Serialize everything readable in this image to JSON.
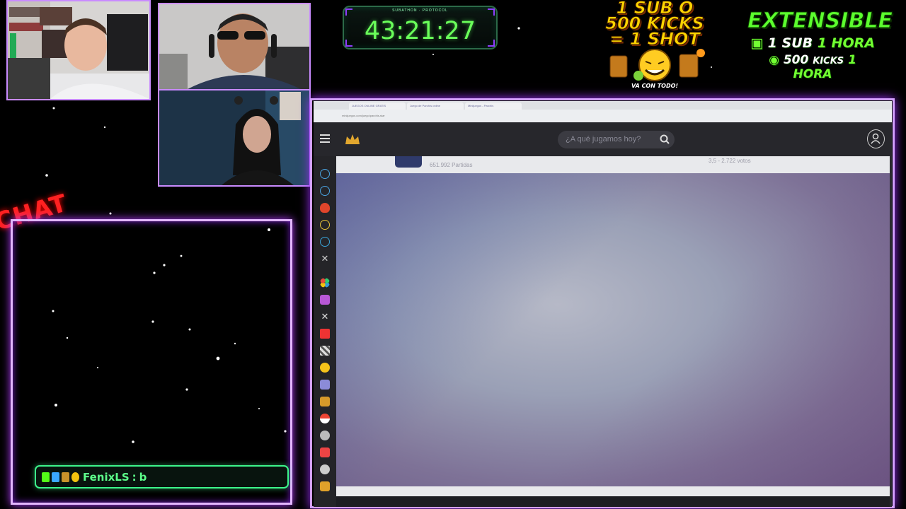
{
  "timer": {
    "label": "SUBATHON · PROTOCOL",
    "value": "43:21:27"
  },
  "promo_left": {
    "line1": "1 SUB O",
    "line2": "500 KICKS",
    "line3": "= 1 SHOT",
    "tagline": "VA CON TODO!"
  },
  "promo_right": {
    "title": "EXTENSIBLE",
    "row1_num": "1 SUB",
    "row1_unit": "1 HORA",
    "row2_num": "500",
    "row2_mid": "KICKS",
    "row2_unit": "1 HORA"
  },
  "chat": {
    "label": "CHAT",
    "message": {
      "user": "FenixLS",
      "separator": ":",
      "text": "b"
    }
  },
  "browser": {
    "tabs": [
      "JUEGOS ONLINE GRATIS",
      "Juego de Parchís online",
      "Minijuegos - Parchís"
    ],
    "url": "minijuegos.com/juego/parchis-star",
    "search_placeholder": "¿A qué jugamos hoy?",
    "game_stats": "651.992 Partidas",
    "game_rating": "3,5 - 2.722 votos"
  },
  "colors": {
    "timer_green": "#6aff5a",
    "neon_purple": "#b43cff",
    "chat_green": "#3df58b",
    "chat_red": "#ff2121"
  }
}
